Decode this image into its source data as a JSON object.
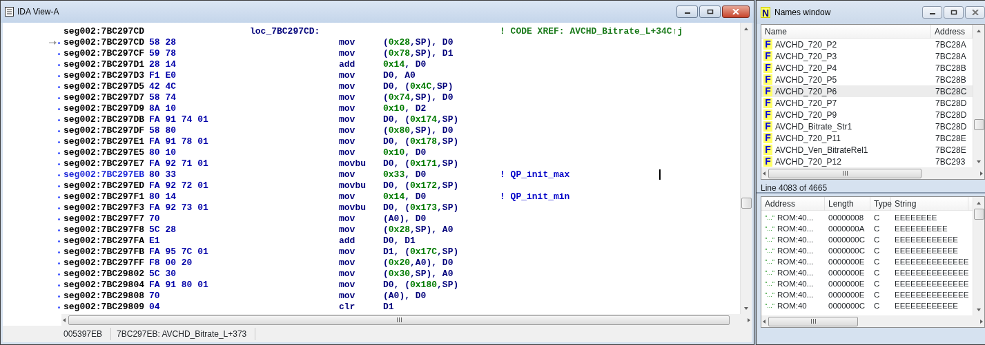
{
  "ida_view": {
    "title": "IDA View-A",
    "lines": [
      {
        "kind": "label",
        "address": "seg002:7BC297CD",
        "label": "loc_7BC297CD:",
        "comment": {
          "kind": "xref",
          "text": "! CODE XREF: AVCHD_Bitrate_L+34C↑j"
        }
      },
      {
        "kind": "insn",
        "jump_target": true,
        "current": false,
        "address": "seg002:7BC297CD",
        "bytes": "58 28",
        "mnemonic": "mov",
        "operands": [
          {
            "kind": "plain",
            "text": "("
          },
          {
            "kind": "num",
            "text": "0x28"
          },
          {
            "kind": "plain",
            "text": ",SP), D0"
          }
        ]
      },
      {
        "kind": "insn",
        "jump_target": false,
        "current": false,
        "address": "seg002:7BC297CF",
        "bytes": "59 78",
        "mnemonic": "mov",
        "operands": [
          {
            "kind": "plain",
            "text": "("
          },
          {
            "kind": "num",
            "text": "0x78"
          },
          {
            "kind": "plain",
            "text": ",SP), D1"
          }
        ]
      },
      {
        "kind": "insn",
        "jump_target": false,
        "current": false,
        "address": "seg002:7BC297D1",
        "bytes": "28 14",
        "mnemonic": "add",
        "operands": [
          {
            "kind": "num",
            "text": "0x14"
          },
          {
            "kind": "plain",
            "text": ", D0"
          }
        ]
      },
      {
        "kind": "insn",
        "jump_target": false,
        "current": false,
        "address": "seg002:7BC297D3",
        "bytes": "F1 E0",
        "mnemonic": "mov",
        "operands": [
          {
            "kind": "plain",
            "text": "D0, A0"
          }
        ]
      },
      {
        "kind": "insn",
        "jump_target": false,
        "current": false,
        "address": "seg002:7BC297D5",
        "bytes": "42 4C",
        "mnemonic": "mov",
        "operands": [
          {
            "kind": "plain",
            "text": "D0, ("
          },
          {
            "kind": "num",
            "text": "0x4C"
          },
          {
            "kind": "plain",
            "text": ",SP)"
          }
        ]
      },
      {
        "kind": "insn",
        "jump_target": false,
        "current": false,
        "address": "seg002:7BC297D7",
        "bytes": "58 74",
        "mnemonic": "mov",
        "operands": [
          {
            "kind": "plain",
            "text": "("
          },
          {
            "kind": "num",
            "text": "0x74"
          },
          {
            "kind": "plain",
            "text": ",SP), D0"
          }
        ]
      },
      {
        "kind": "insn",
        "jump_target": false,
        "current": false,
        "address": "seg002:7BC297D9",
        "bytes": "8A 10",
        "mnemonic": "mov",
        "operands": [
          {
            "kind": "num",
            "text": "0x10"
          },
          {
            "kind": "plain",
            "text": ", D2"
          }
        ]
      },
      {
        "kind": "insn",
        "jump_target": false,
        "current": false,
        "address": "seg002:7BC297DB",
        "bytes": "FA 91 74 01",
        "mnemonic": "mov",
        "operands": [
          {
            "kind": "plain",
            "text": "D0, ("
          },
          {
            "kind": "num",
            "text": "0x174"
          },
          {
            "kind": "plain",
            "text": ",SP)"
          }
        ]
      },
      {
        "kind": "insn",
        "jump_target": false,
        "current": false,
        "address": "seg002:7BC297DF",
        "bytes": "58 80",
        "mnemonic": "mov",
        "operands": [
          {
            "kind": "plain",
            "text": "("
          },
          {
            "kind": "num",
            "text": "0x80"
          },
          {
            "kind": "plain",
            "text": ",SP), D0"
          }
        ]
      },
      {
        "kind": "insn",
        "jump_target": false,
        "current": false,
        "address": "seg002:7BC297E1",
        "bytes": "FA 91 78 01",
        "mnemonic": "mov",
        "operands": [
          {
            "kind": "plain",
            "text": "D0, ("
          },
          {
            "kind": "num",
            "text": "0x178"
          },
          {
            "kind": "plain",
            "text": ",SP)"
          }
        ]
      },
      {
        "kind": "insn",
        "jump_target": false,
        "current": false,
        "address": "seg002:7BC297E5",
        "bytes": "80 10",
        "mnemonic": "mov",
        "operands": [
          {
            "kind": "num",
            "text": "0x10"
          },
          {
            "kind": "plain",
            "text": ", D0"
          }
        ]
      },
      {
        "kind": "insn",
        "jump_target": false,
        "current": false,
        "address": "seg002:7BC297E7",
        "bytes": "FA 92 71 01",
        "mnemonic": "movbu",
        "operands": [
          {
            "kind": "plain",
            "text": "D0, ("
          },
          {
            "kind": "num",
            "text": "0x171"
          },
          {
            "kind": "plain",
            "text": ",SP)"
          }
        ]
      },
      {
        "kind": "insn",
        "jump_target": false,
        "current": true,
        "address": "seg002:7BC297EB",
        "bytes": "80 33",
        "mnemonic": "mov",
        "operands": [
          {
            "kind": "num",
            "text": "0x33"
          },
          {
            "kind": "plain",
            "text": ", D0"
          }
        ],
        "comment": {
          "kind": "regular",
          "text": "! QP_init_max"
        }
      },
      {
        "kind": "insn",
        "jump_target": false,
        "current": false,
        "address": "seg002:7BC297ED",
        "bytes": "FA 92 72 01",
        "mnemonic": "movbu",
        "operands": [
          {
            "kind": "plain",
            "text": "D0, ("
          },
          {
            "kind": "num",
            "text": "0x172"
          },
          {
            "kind": "plain",
            "text": ",SP)"
          }
        ]
      },
      {
        "kind": "insn",
        "jump_target": false,
        "current": false,
        "address": "seg002:7BC297F1",
        "bytes": "80 14",
        "mnemonic": "mov",
        "operands": [
          {
            "kind": "num",
            "text": "0x14"
          },
          {
            "kind": "plain",
            "text": ", D0"
          }
        ],
        "comment": {
          "kind": "regular",
          "text": "! QP_init_min"
        }
      },
      {
        "kind": "insn",
        "jump_target": false,
        "current": false,
        "address": "seg002:7BC297F3",
        "bytes": "FA 92 73 01",
        "mnemonic": "movbu",
        "operands": [
          {
            "kind": "plain",
            "text": "D0, ("
          },
          {
            "kind": "num",
            "text": "0x173"
          },
          {
            "kind": "plain",
            "text": ",SP)"
          }
        ]
      },
      {
        "kind": "insn",
        "jump_target": false,
        "current": false,
        "address": "seg002:7BC297F7",
        "bytes": "70",
        "mnemonic": "mov",
        "operands": [
          {
            "kind": "plain",
            "text": "(A0), D0"
          }
        ]
      },
      {
        "kind": "insn",
        "jump_target": false,
        "current": false,
        "address": "seg002:7BC297F8",
        "bytes": "5C 28",
        "mnemonic": "mov",
        "operands": [
          {
            "kind": "plain",
            "text": "("
          },
          {
            "kind": "num",
            "text": "0x28"
          },
          {
            "kind": "plain",
            "text": ",SP), A0"
          }
        ]
      },
      {
        "kind": "insn",
        "jump_target": false,
        "current": false,
        "address": "seg002:7BC297FA",
        "bytes": "E1",
        "mnemonic": "add",
        "operands": [
          {
            "kind": "plain",
            "text": "D0, D1"
          }
        ]
      },
      {
        "kind": "insn",
        "jump_target": false,
        "current": false,
        "address": "seg002:7BC297FB",
        "bytes": "FA 95 7C 01",
        "mnemonic": "mov",
        "operands": [
          {
            "kind": "plain",
            "text": "D1, ("
          },
          {
            "kind": "num",
            "text": "0x17C"
          },
          {
            "kind": "plain",
            "text": ",SP)"
          }
        ]
      },
      {
        "kind": "insn",
        "jump_target": false,
        "current": false,
        "address": "seg002:7BC297FF",
        "bytes": "F8 00 20",
        "mnemonic": "mov",
        "operands": [
          {
            "kind": "plain",
            "text": "("
          },
          {
            "kind": "num",
            "text": "0x20"
          },
          {
            "kind": "plain",
            "text": ",A0), D0"
          }
        ]
      },
      {
        "kind": "insn",
        "jump_target": false,
        "current": false,
        "address": "seg002:7BC29802",
        "bytes": "5C 30",
        "mnemonic": "mov",
        "operands": [
          {
            "kind": "plain",
            "text": "("
          },
          {
            "kind": "num",
            "text": "0x30"
          },
          {
            "kind": "plain",
            "text": ",SP), A0"
          }
        ]
      },
      {
        "kind": "insn",
        "jump_target": false,
        "current": false,
        "address": "seg002:7BC29804",
        "bytes": "FA 91 80 01",
        "mnemonic": "mov",
        "operands": [
          {
            "kind": "plain",
            "text": "D0, ("
          },
          {
            "kind": "num",
            "text": "0x180"
          },
          {
            "kind": "plain",
            "text": ",SP)"
          }
        ]
      },
      {
        "kind": "insn",
        "jump_target": false,
        "current": false,
        "address": "seg002:7BC29808",
        "bytes": "70",
        "mnemonic": "mov",
        "operands": [
          {
            "kind": "plain",
            "text": "(A0), D0"
          }
        ]
      },
      {
        "kind": "insn",
        "jump_target": false,
        "current": false,
        "address": "seg002:7BC29809",
        "bytes": "04",
        "mnemonic": "clr",
        "operands": [
          {
            "kind": "plain",
            "text": "D1"
          }
        ]
      }
    ],
    "status_bar": [
      "005397EB",
      "7BC297EB: AVCHD_Bitrate_L+373"
    ]
  },
  "names_window": {
    "icon": "N",
    "title": "Names window",
    "columns": [
      "Name",
      "Address"
    ],
    "rows": [
      {
        "icon": "F",
        "name": "AVCHD_720_P2",
        "address": "7BC28A",
        "selected": false
      },
      {
        "icon": "F",
        "name": "AVCHD_720_P3",
        "address": "7BC28A",
        "selected": false
      },
      {
        "icon": "F",
        "name": "AVCHD_720_P4",
        "address": "7BC28B",
        "selected": false
      },
      {
        "icon": "F",
        "name": "AVCHD_720_P5",
        "address": "7BC28B",
        "selected": false
      },
      {
        "icon": "F",
        "name": "AVCHD_720_P6",
        "address": "7BC28C",
        "selected": true
      },
      {
        "icon": "F",
        "name": "AVCHD_720_P7",
        "address": "7BC28D",
        "selected": false
      },
      {
        "icon": "F",
        "name": "AVCHD_720_P9",
        "address": "7BC28D",
        "selected": false
      },
      {
        "icon": "F",
        "name": "AVCHD_Bitrate_Str1",
        "address": "7BC28D",
        "selected": false
      },
      {
        "icon": "F",
        "name": "AVCHD_720_P11",
        "address": "7BC28E",
        "selected": false
      },
      {
        "icon": "F",
        "name": "AVCHD_Ven_BitrateRel1",
        "address": "7BC28E",
        "selected": false
      },
      {
        "icon": "F",
        "name": "AVCHD_720_P12",
        "address": "7BC293",
        "selected": false
      }
    ],
    "status": "Line 4083 of 4665"
  },
  "strings_window": {
    "columns": [
      "Address",
      "Length",
      "Type",
      "String"
    ],
    "rows": [
      {
        "marker": "\"...\"",
        "address": "ROM:40...",
        "length": "00000008",
        "type": "C",
        "string": "EEEEEEEE"
      },
      {
        "marker": "\"...\"",
        "address": "ROM:40...",
        "length": "0000000A",
        "type": "C",
        "string": "EEEEEEEEEE"
      },
      {
        "marker": "\"...\"",
        "address": "ROM:40...",
        "length": "0000000C",
        "type": "C",
        "string": "EEEEEEEEEEEE"
      },
      {
        "marker": "\"...\"",
        "address": "ROM:40...",
        "length": "0000000C",
        "type": "C",
        "string": "EEEEEEEEEEEE"
      },
      {
        "marker": "\"...\"",
        "address": "ROM:40...",
        "length": "0000000E",
        "type": "C",
        "string": "EEEEEEEEEEEEEE"
      },
      {
        "marker": "\"...\"",
        "address": "ROM:40...",
        "length": "0000000E",
        "type": "C",
        "string": "EEEEEEEEEEEEEE"
      },
      {
        "marker": "\"...\"",
        "address": "ROM:40...",
        "length": "0000000E",
        "type": "C",
        "string": "EEEEEEEEEEEEEE"
      },
      {
        "marker": "\"...\"",
        "address": "ROM:40...",
        "length": "0000000E",
        "type": "C",
        "string": "EEEEEEEEEEEEEE"
      },
      {
        "marker": "\"...\"",
        "address": "ROM:40",
        "length": "0000000C",
        "type": "C",
        "string": "EEEEEEEEEEEE"
      }
    ]
  }
}
